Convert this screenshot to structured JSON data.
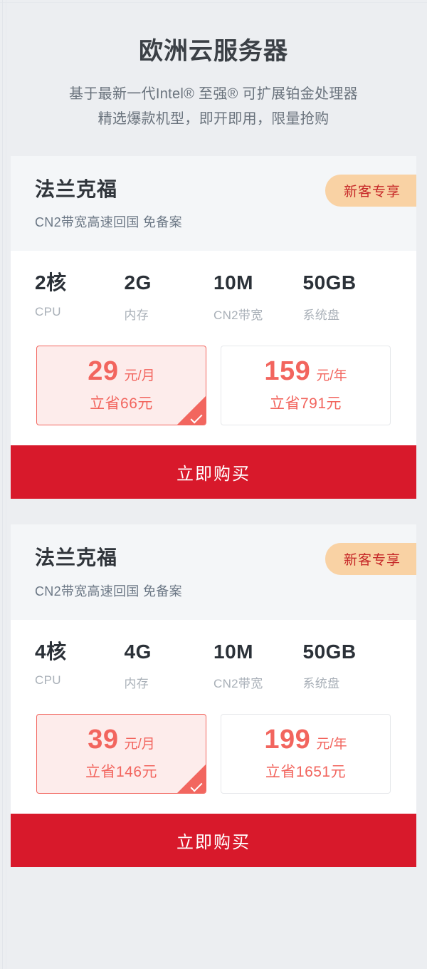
{
  "hero": {
    "title": "欧洲云服务器",
    "sub_line1": "基于最新一代Intel® 至强® 可扩展铂金处理器",
    "sub_line2": "精选爆款机型，即开即用，限量抢购"
  },
  "colors": {
    "page_bg": "#eceef1",
    "card_head_bg": "#f4f6f8",
    "accent_red": "#f2655e",
    "button_red": "#d8192b",
    "badge_bg": "#f9d2a4",
    "badge_text": "#c62828",
    "title_text": "#3b4046",
    "muted_text": "#a9b0b8"
  },
  "cards": [
    {
      "title": "法兰克福",
      "subtitle": "CN2带宽高速回国 免备案",
      "badge": "新客专享",
      "specs": [
        {
          "value": "2核",
          "label": "CPU"
        },
        {
          "value": "2G",
          "label": "内存"
        },
        {
          "value": "10M",
          "label": "CN2带宽"
        },
        {
          "value": "50GB",
          "label": "系统盘"
        }
      ],
      "prices": [
        {
          "amount": "29",
          "unit": "元/月",
          "save": "立省66元",
          "selected": true
        },
        {
          "amount": "159",
          "unit": "元/年",
          "save": "立省791元",
          "selected": false
        }
      ],
      "buy_label": "立即购买"
    },
    {
      "title": "法兰克福",
      "subtitle": "CN2带宽高速回国 免备案",
      "badge": "新客专享",
      "specs": [
        {
          "value": "4核",
          "label": "CPU"
        },
        {
          "value": "4G",
          "label": "内存"
        },
        {
          "value": "10M",
          "label": "CN2带宽"
        },
        {
          "value": "50GB",
          "label": "系统盘"
        }
      ],
      "prices": [
        {
          "amount": "39",
          "unit": "元/月",
          "save": "立省146元",
          "selected": true
        },
        {
          "amount": "199",
          "unit": "元/年",
          "save": "立省1651元",
          "selected": false
        }
      ],
      "buy_label": "立即购买"
    }
  ]
}
